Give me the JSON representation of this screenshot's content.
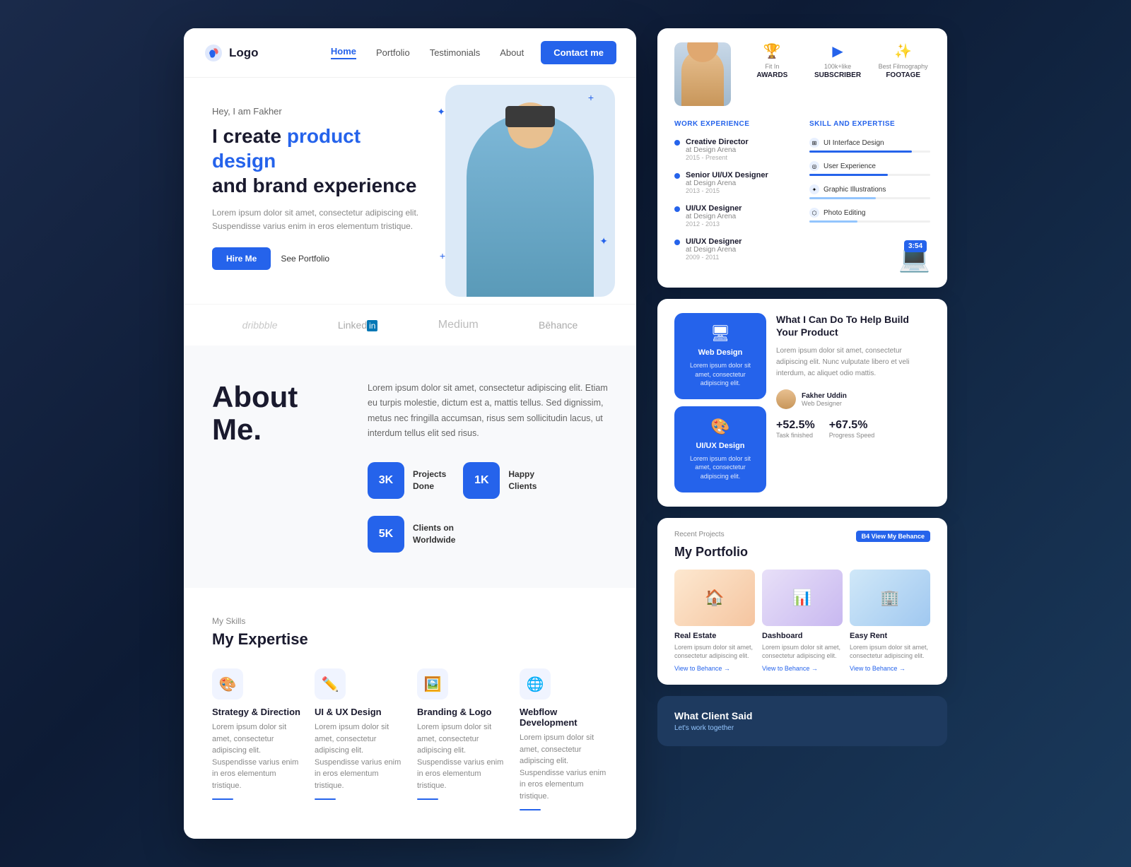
{
  "leftPanel": {
    "navbar": {
      "logo": "Logo",
      "links": [
        {
          "label": "Home",
          "active": true
        },
        {
          "label": "Portfolio",
          "active": false
        },
        {
          "label": "Testimonials",
          "active": false
        },
        {
          "label": "About",
          "active": false
        }
      ],
      "contactBtn": "Contact me"
    },
    "hero": {
      "greeting": "Hey, I am Fakher",
      "title1": "I create ",
      "titleHighlight": "product design",
      "title2": "and brand experience",
      "description": "Lorem ipsum dolor sit amet, consectetur adipiscing elit.\nSuspendisse varius enim in eros elementum tristique.",
      "hireBtn": "Hire Me",
      "portfolioBtn": "See Portfolio"
    },
    "brands": [
      "Dribbble",
      "LinkedIn",
      "Medium",
      "Behance"
    ],
    "about": {
      "title": "About\nMe.",
      "description": "Lorem ipsum dolor sit amet, consectetur adipiscing elit. Etiam eu turpis molestie, dictum est a, mattis tellus. Sed dignissim, metus nec fringilla accumsan, risus sem sollicitudin lacus, ut interdum tellus elit sed risus.",
      "stats": [
        {
          "value": "3K",
          "label1": "Projects",
          "label2": "Done"
        },
        {
          "value": "1K",
          "label1": "Happy",
          "label2": "Clients"
        },
        {
          "value": "5K",
          "label1": "Clients on",
          "label2": "Worldwide"
        }
      ]
    },
    "skills": {
      "label": "My Skills",
      "title": "My Expertise",
      "items": [
        {
          "icon": "🎨",
          "name": "Strategy & Direction",
          "desc": "Lorem ipsum dolor sit amet, consectetur adipiscing elit. Suspendisse varius enim in eros elementum tristique."
        },
        {
          "icon": "✏️",
          "name": "UI & UX Design",
          "desc": "Lorem ipsum dolor sit amet, consectetur adipiscing elit. Suspendisse varius enim in eros elementum tristique."
        },
        {
          "icon": "🖼️",
          "name": "Branding & Logo",
          "desc": "Lorem ipsum dolor sit amet, consectetur adipiscing elit. Suspendisse varius enim in eros elementum tristique."
        },
        {
          "icon": "🌐",
          "name": "Webflow Development",
          "desc": "Lorem ipsum dolor sit amet, consectetur adipiscing elit. Suspendisse varius enim in eros elementum tristique."
        }
      ]
    }
  },
  "rightPanel": {
    "profile": {
      "badges": [
        {
          "icon": "🏆",
          "title": "Fit In",
          "label": "AWARDS"
        },
        {
          "icon": "▶",
          "title": "100k+like",
          "label": "SUBSCRIBER"
        },
        {
          "icon": "✨",
          "title": "Best Filmography",
          "label": "FOOTAGE"
        }
      ]
    },
    "workExp": {
      "sectionLabel": "WORK EXPERIENCE",
      "items": [
        {
          "role": "Creative Director",
          "company": "at Design Arena",
          "period": "2015 - Present"
        },
        {
          "role": "Senior UI/UX Designer",
          "company": "at Design Arena",
          "period": "2013 - 2015"
        },
        {
          "role": "UI/UX Designer",
          "company": "at Design Arena",
          "period": "2012 - 2013"
        },
        {
          "role": "UI/UX Designer",
          "company": "at Design Arena",
          "period": "2009 - 2011"
        }
      ]
    },
    "skillExpertise": {
      "sectionLabel": "SKILL AND EXPERTISE",
      "items": [
        {
          "name": "UI Interface Design",
          "fill": 85,
          "light": false
        },
        {
          "name": "User Experience",
          "fill": 65,
          "light": false
        },
        {
          "name": "Graphic Illustrations",
          "fill": 55,
          "light": true
        },
        {
          "name": "Photo Editing",
          "fill": 40,
          "light": true
        }
      ]
    },
    "services": {
      "boxes": [
        {
          "icon": "🖥",
          "name": "Web Design",
          "desc": "Lorem ipsum dolor sit amet, consectetur adipiscing elit."
        },
        {
          "icon": "🎨",
          "name": "UI/UX Design",
          "desc": "Lorem ipsum dolor sit amet, consectetur adipiscing elit."
        }
      ],
      "title": "What I Can Do To Help Build Your Product",
      "desc": "Lorem ipsum dolor sit amet, consectetur adipiscing elit. Nunc vulputate libero et veli interdum, ac aliquet odio mattis.",
      "reviewer": {
        "name": "Fakher Uddin",
        "role": "Web Designer"
      },
      "metrics": [
        {
          "value": "+52.5%",
          "label": "Task finished"
        },
        {
          "value": "+67.5%",
          "label": "Progress Speed"
        }
      ]
    },
    "portfolio": {
      "recentLabel": "Recent Projects",
      "title": "My Portfolio",
      "behanceBadge": "B4 View My Behance",
      "items": [
        {
          "name": "Real Estate",
          "desc": "Lorem ipsum dolor sit amet, consectetur adipiscing elit.",
          "viewLabel": "View to Behance →"
        },
        {
          "name": "Dashboard",
          "desc": "Lorem ipsum dolor sit amet, consectetur adipiscing elit.",
          "viewLabel": "View to Behance →"
        },
        {
          "name": "Easy Rent",
          "desc": "Lorem ipsum dolor sit amet, consectetur adipiscing elit.",
          "viewLabel": "View to Behance →"
        }
      ]
    },
    "client": {
      "title": "What Client Said",
      "sub": "Let's work together"
    }
  }
}
